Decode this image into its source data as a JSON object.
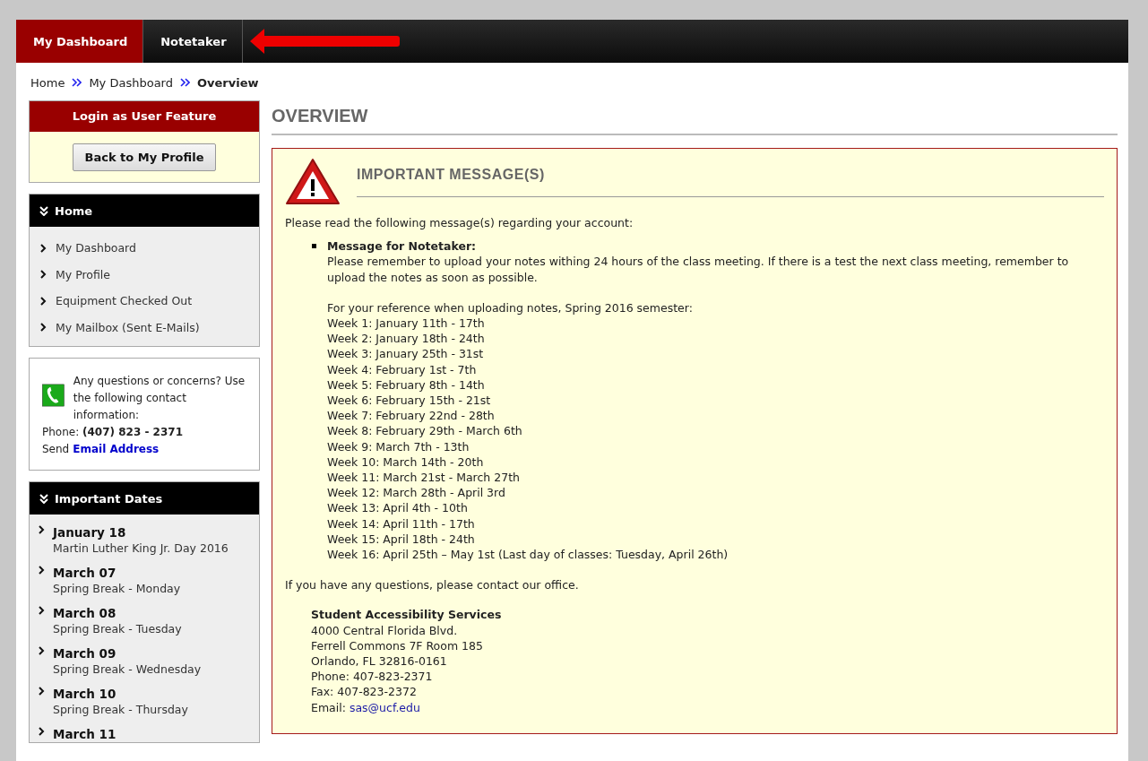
{
  "nav": {
    "tabs": [
      {
        "label": "My Dashboard",
        "selected": true
      },
      {
        "label": "Notetaker",
        "selected": false
      }
    ]
  },
  "breadcrumb": [
    {
      "label": "Home",
      "current": false
    },
    {
      "label": "My Dashboard",
      "current": false
    },
    {
      "label": "Overview",
      "current": true
    }
  ],
  "sidebar": {
    "login_panel": {
      "title": "Login as User Feature",
      "button": "Back to My Profile"
    },
    "home_panel": {
      "title": "Home",
      "items": [
        "My Dashboard",
        "My Profile",
        "Equipment Checked Out",
        "My Mailbox (Sent E-Mails)"
      ]
    },
    "contact": {
      "text": "Any questions or concerns? Use the following contact information:",
      "phone": "Phone: **(407) 823 - 2371**",
      "send_label": "Send",
      "email_link": "Email Address"
    },
    "dates_panel": {
      "title": "Important Dates",
      "items": [
        {
          "date": "January 18",
          "description": "Martin Luther King Jr. Day 2016"
        },
        {
          "date": "March 07",
          "description": "Spring Break - Monday"
        },
        {
          "date": "March 08",
          "description": "Spring Break - Tuesday"
        },
        {
          "date": "March 09",
          "description": "Spring Break - Wednesday"
        },
        {
          "date": "March 10",
          "description": "Spring Break - Thursday"
        },
        {
          "date": "March 11"
        }
      ]
    }
  },
  "main": {
    "heading": "OVERVIEW",
    "message": {
      "title": "IMPORTANT MESSAGE(S)",
      "intro": "Please read the following message(s) regarding your account:",
      "item_title": "Message for Notetaker:",
      "item_text": "Please remember to upload your notes withing 24 hours of the class meeting. If there is a test the next class meeting, remember to upload the notes as soon as possible.",
      "reference_intro": "For your reference when uploading notes, Spring 2016 semester:",
      "weeks": [
        "Week 1: January 11th - 17th",
        "Week 2: January 18th - 24th",
        "Week 3: January 25th - 31st",
        "Week 4: February 1st - 7th",
        "Week 5: February 8th - 14th",
        "Week 6: February 15th - 21st",
        "Week 7: February 22nd - 28th",
        "Week 8: February 29th - March 6th",
        "Week 9: March 7th - 13th",
        "Week 10: March 14th - 20th",
        "Week 11: March 21st - March 27th",
        "Week 12: March 28th - April 3rd",
        "Week 13: April 4th - 10th",
        "Week 14: April 11th - 17th",
        "Week 15: April 18th - 24th",
        "Week 16: April 25th – May 1st (Last day of classes: Tuesday, April 26th)"
      ],
      "outro": "If you have any questions, please contact our office.",
      "office": {
        "name": "Student Accessibility Services",
        "lines": [
          "4000 Central Florida Blvd.",
          "Ferrell Commons 7F Room 185",
          "Orlando, FL 32816-0161",
          "Phone: 407-823-2371",
          "Fax: 407-823-2372"
        ],
        "email_label": "Email:",
        "email": "sas@ucf.edu"
      }
    }
  }
}
